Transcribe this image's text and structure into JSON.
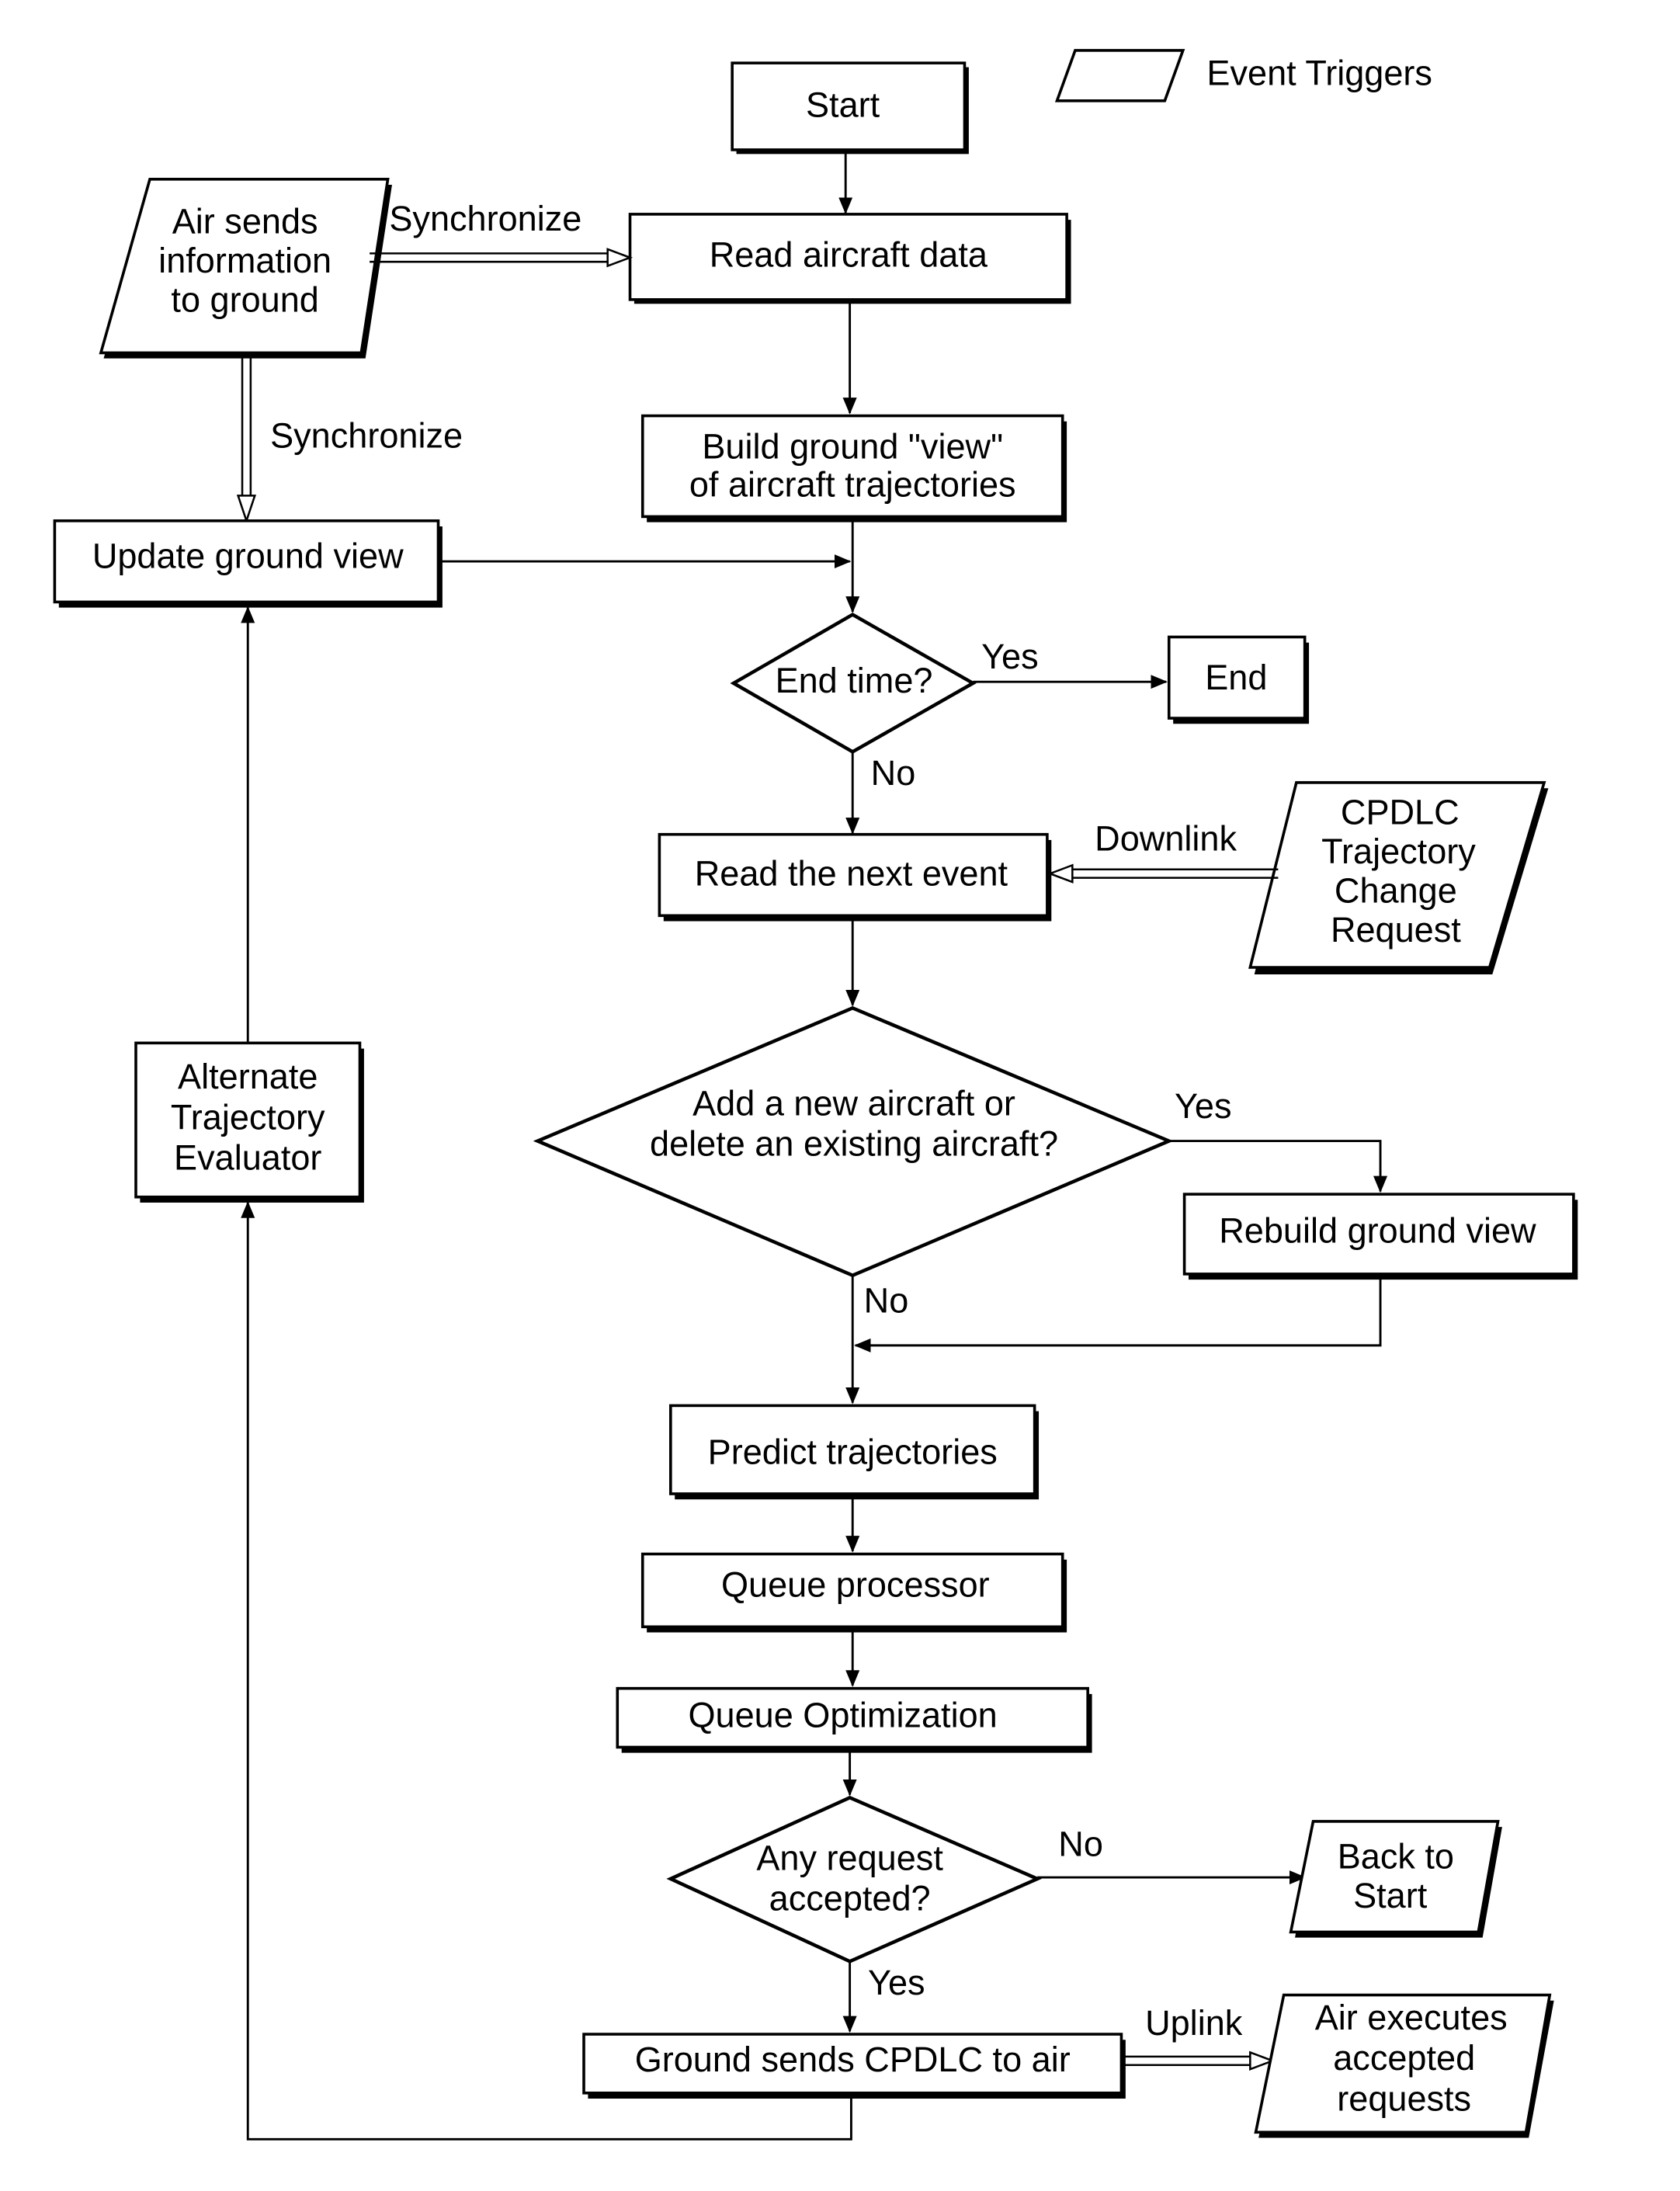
{
  "legend": {
    "label": "Event Triggers",
    "icon": "parallelogram-icon"
  },
  "nodes": {
    "start": {
      "label": "Start"
    },
    "read_aircraft": {
      "label": "Read aircraft data"
    },
    "build_view": {
      "lines": [
        "Build ground \"view\"",
        "of aircraft trajectories"
      ]
    },
    "update_view": {
      "label": "Update ground view"
    },
    "end_time": {
      "label": "End time?"
    },
    "end": {
      "label": "End"
    },
    "read_next": {
      "label": "Read the next event"
    },
    "add_delete": {
      "lines": [
        "Add a new aircraft or",
        "delete an existing aircraft?"
      ]
    },
    "rebuild": {
      "label": "Rebuild ground view"
    },
    "predict": {
      "label": "Predict trajectories"
    },
    "queue_proc": {
      "label": "Queue processor"
    },
    "queue_opt": {
      "label": "Queue Optimization"
    },
    "any_request": {
      "lines": [
        "Any request",
        "accepted?"
      ]
    },
    "back_start": {
      "lines": [
        "Back to",
        "Start"
      ]
    },
    "ground_sends": {
      "label": "Ground sends CPDLC to air"
    },
    "alt_eval": {
      "lines": [
        "Alternate",
        "Trajectory",
        "Evaluator"
      ]
    },
    "air_sends": {
      "lines": [
        "Air sends",
        "information",
        "to ground"
      ]
    },
    "cpdlc_req": {
      "lines": [
        "CPDLC",
        "Trajectory",
        "Change",
        "Request"
      ]
    },
    "air_executes": {
      "lines": [
        "Air executes",
        "accepted",
        "requests"
      ]
    }
  },
  "edge_labels": {
    "sync1": "Synchronize",
    "sync2": "Synchronize",
    "yes1": "Yes",
    "no1": "No",
    "downlink": "Downlink",
    "yes2": "Yes",
    "no2": "No",
    "no3": "No",
    "yes3": "Yes",
    "uplink": "Uplink"
  }
}
